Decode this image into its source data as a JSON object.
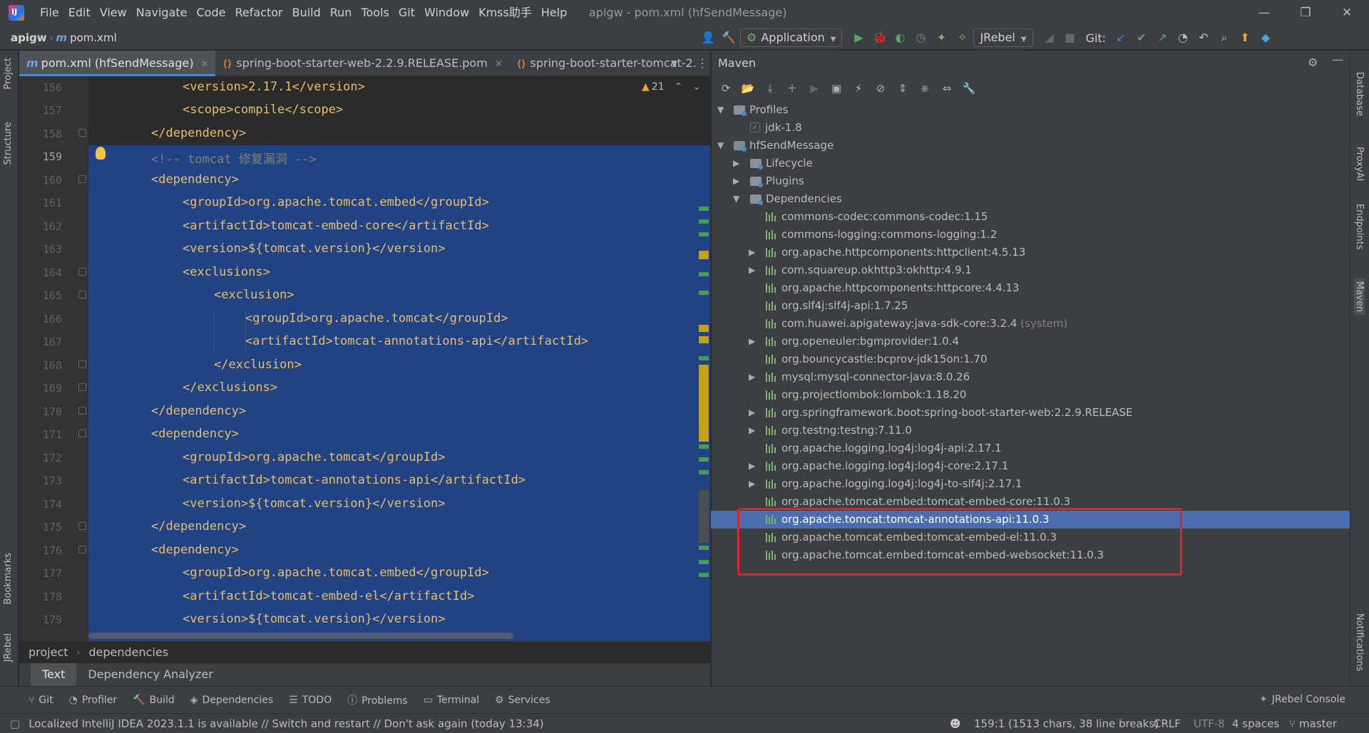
{
  "window": {
    "title": "apigw - pom.xml (hfSendMessage)",
    "menu": [
      "File",
      "Edit",
      "View",
      "Navigate",
      "Code",
      "Refactor",
      "Build",
      "Run",
      "Tools",
      "Git",
      "Window",
      "Kmss助手",
      "Help"
    ],
    "minimize": "—",
    "restore": "❐",
    "close": "✕"
  },
  "navbar": {
    "project": "apigw",
    "file": "pom.xml",
    "run_config": "Application",
    "jrebel": "JRebel",
    "git_label": "Git:"
  },
  "left_strip": {
    "project": "Project",
    "structure": "Structure",
    "bookmarks": "Bookmarks",
    "jrebel": "JRebel"
  },
  "right_strip": {
    "database": "Database",
    "proxyai": "ProxyAI",
    "endpoints": "Endpoints",
    "maven": "Maven",
    "notifications": "Notifications"
  },
  "editor": {
    "tabs": [
      {
        "label": "pom.xml (hfSendMessage)"
      },
      {
        "label": "spring-boot-starter-web-2.2.9.RELEASE.pom"
      },
      {
        "label": "spring-boot-starter-tomcat-2."
      }
    ],
    "warnings": "21",
    "lines": [
      {
        "n": "156",
        "code": "<version>2.17.1</version>"
      },
      {
        "n": "157",
        "code": "<scope>compile</scope>"
      },
      {
        "n": "158",
        "code": "</dependency>"
      },
      {
        "n": "159",
        "code": "<!-- tomcat 修复漏洞 -->"
      },
      {
        "n": "160",
        "code": "<dependency>"
      },
      {
        "n": "161",
        "code": "<groupId>org.apache.tomcat.embed</groupId>"
      },
      {
        "n": "162",
        "code": "<artifactId>tomcat-embed-core</artifactId>"
      },
      {
        "n": "163",
        "code": "<version>${tomcat.version}</version>"
      },
      {
        "n": "164",
        "code": "<exclusions>"
      },
      {
        "n": "165",
        "code": "<exclusion>"
      },
      {
        "n": "166",
        "code": "<groupId>org.apache.tomcat</groupId>"
      },
      {
        "n": "167",
        "code": "<artifactId>tomcat-annotations-api</artifactId>"
      },
      {
        "n": "168",
        "code": "</exclusion>"
      },
      {
        "n": "169",
        "code": "</exclusions>"
      },
      {
        "n": "170",
        "code": "</dependency>"
      },
      {
        "n": "171",
        "code": "<dependency>"
      },
      {
        "n": "172",
        "code": "<groupId>org.apache.tomcat</groupId>"
      },
      {
        "n": "173",
        "code": "<artifactId>tomcat-annotations-api</artifactId>"
      },
      {
        "n": "174",
        "code": "<version>${tomcat.version}</version>"
      },
      {
        "n": "175",
        "code": "</dependency>"
      },
      {
        "n": "176",
        "code": "<dependency>"
      },
      {
        "n": "177",
        "code": "<groupId>org.apache.tomcat.embed</groupId>"
      },
      {
        "n": "178",
        "code": "<artifactId>tomcat-embed-el</artifactId>"
      },
      {
        "n": "179",
        "code": "<version>${tomcat.version}</version>"
      }
    ],
    "breadcrumb": [
      "project",
      "dependencies"
    ],
    "subtabs": [
      "Text",
      "Dependency Analyzer"
    ]
  },
  "maven": {
    "title": "Maven",
    "tree": [
      {
        "label": "Profiles",
        "kind": "folder"
      },
      {
        "label": "jdk-1.8",
        "kind": "profile"
      },
      {
        "label": "hfSendMessage",
        "kind": "module"
      },
      {
        "label": "Lifecycle",
        "kind": "folder"
      },
      {
        "label": "Plugins",
        "kind": "folder"
      },
      {
        "label": "Dependencies",
        "kind": "folder"
      },
      {
        "label": "commons-codec:commons-codec:1.15",
        "kind": "dep"
      },
      {
        "label": "commons-logging:commons-logging:1.2",
        "kind": "dep"
      },
      {
        "label": "org.apache.httpcomponents:httpclient:4.5.13",
        "kind": "dep"
      },
      {
        "label": "com.squareup.okhttp3:okhttp:4.9.1",
        "kind": "dep"
      },
      {
        "label": "org.apache.httpcomponents:httpcore:4.4.13",
        "kind": "dep"
      },
      {
        "label": "org.slf4j:slf4j-api:1.7.25",
        "kind": "dep"
      },
      {
        "label": "com.huawei.apigateway:java-sdk-core:3.2.4",
        "suffix": "(system)",
        "kind": "dep"
      },
      {
        "label": "org.openeuler:bgmprovider:1.0.4",
        "kind": "dep"
      },
      {
        "label": "org.bouncycastle:bcprov-jdk15on:1.70",
        "kind": "dep"
      },
      {
        "label": "mysql:mysql-connector-java:8.0.26",
        "kind": "dep"
      },
      {
        "label": "org.projectlombok:lombok:1.18.20",
        "kind": "dep"
      },
      {
        "label": "org.springframework.boot:spring-boot-starter-web:2.2.9.RELEASE",
        "kind": "dep"
      },
      {
        "label": "org.testng:testng:7.11.0",
        "kind": "dep"
      },
      {
        "label": "org.apache.logging.log4j:log4j-api:2.17.1",
        "kind": "dep"
      },
      {
        "label": "org.apache.logging.log4j:log4j-core:2.17.1",
        "kind": "dep"
      },
      {
        "label": "org.apache.logging.log4j:log4j-to-slf4j:2.17.1",
        "kind": "dep"
      },
      {
        "label": "org.apache.tomcat.embed:tomcat-embed-core:11.0.3",
        "kind": "dep"
      },
      {
        "label": "org.apache.tomcat:tomcat-annotations-api:11.0.3",
        "kind": "dep"
      },
      {
        "label": "org.apache.tomcat.embed:tomcat-embed-el:11.0.3",
        "kind": "dep"
      },
      {
        "label": "org.apache.tomcat.embed:tomcat-embed-websocket:11.0.3",
        "kind": "dep"
      }
    ]
  },
  "bottom_tools": [
    "Git",
    "Profiler",
    "Build",
    "Dependencies",
    "TODO",
    "Problems",
    "Terminal",
    "Services"
  ],
  "jrebel_console": "JRebel Console",
  "status": {
    "message": "Localized IntelliJ IDEA 2023.1.1 is available // Switch and restart // Don't ask again (today 13:34)",
    "position": "159:1 (1513 chars, 38 line breaks)",
    "line_sep": "CRLF",
    "encoding": "UTF-8",
    "indent": "4 spaces",
    "branch": "master"
  }
}
